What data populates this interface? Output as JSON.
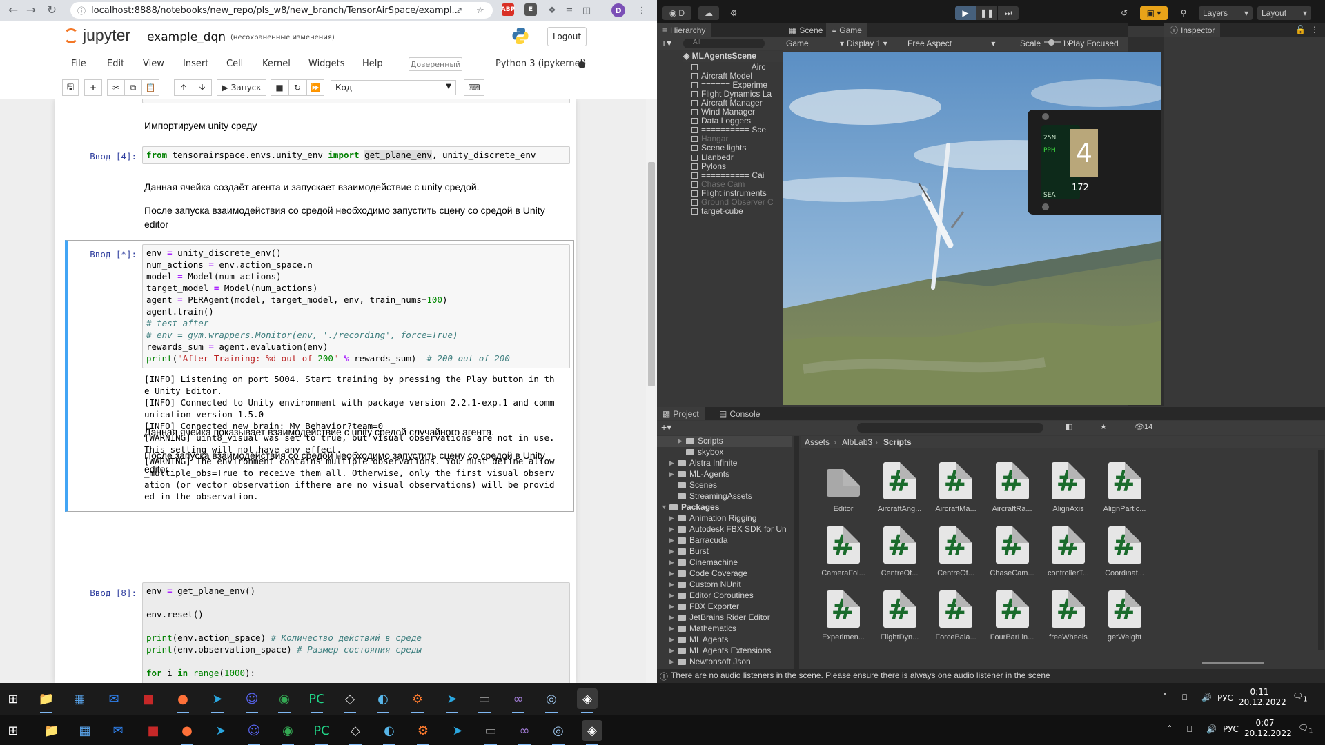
{
  "browser": {
    "url": "localhost:8888/notebooks/new_repo/pls_w8/new_branch/TensorAirSpace/exampl...",
    "ext_abp": "ABP",
    "ext_e": "E",
    "profile": "D"
  },
  "jupyter": {
    "logo": "jupyter",
    "notebook_name": "example_dqn",
    "save_status": "(несохраненные изменения)",
    "logout": "Logout",
    "menu": [
      "File",
      "Edit",
      "View",
      "Insert",
      "Cell",
      "Kernel",
      "Widgets",
      "Help"
    ],
    "trusted": "Доверенный",
    "kernel": "Python 3 (ipykernel)",
    "toolbar": {
      "run": "Запуск",
      "cell_type": "Код"
    }
  },
  "notebook": {
    "md1": "Импортируем unity среду",
    "prompt4": "Ввод [4]:",
    "code4": "from tensorairspace.envs.unity_env import get_plane_env, unity_discrete_env",
    "md2": "Данная ячейка создаёт агента и запускает взаимодействие с unity средой.",
    "md3a": "После запуска взаимодействия со средой необходимо запустить сцену со средой в Unity",
    "md3b": "editor",
    "prompt_star": "Ввод [*]:",
    "code_star": [
      "env = unity_discrete_env()",
      "num_actions = env.action_space.n",
      "model = Model(num_actions)",
      "target_model = Model(num_actions)",
      "agent = PERAgent(model, target_model, env, train_nums=100)",
      "agent.train()",
      "# test after",
      "# env = gym.wrappers.Monitor(env, './recording', force=True)",
      "rewards_sum = agent.evaluation(env)",
      "print(\"After Training: %d out of 200\" % rewards_sum)  # 200 out of 200"
    ],
    "output": [
      "[INFO] Listening on port 5004. Start training by pressing the Play button in th",
      "e Unity Editor.",
      "[INFO] Connected to Unity environment with package version 2.2.1-exp.1 and comm",
      "unication version 1.5.0",
      "[INFO] Connected new brain: My Behavior?team=0",
      "[WARNING] uint8_visual was set to true, but visual observations are not in use.",
      "This setting will not have any effect.",
      "[WARNING] The environment contains multiple observations. You must define allow",
      "_multiple_obs=True to receive them all. Otherwise, only the first visual observ",
      "ation (or vector observation ifthere are no visual observations) will be provid",
      "ed in the observation."
    ],
    "md4": "Данная ячейка показывает взаимодействие с unity средой случайного агента.",
    "md5a": "После запуска взаимодействия со средой необходимо запустить сцену со средой в Unity",
    "md5b": "editor",
    "prompt8": "Ввод [8]:",
    "code8": [
      "env = get_plane_env()",
      "",
      "env.reset()",
      "",
      "print(env.action_space) # Количество действий в среде",
      "print(env.observation_space) # Размер состояния среды",
      "",
      "for i in range(1000):"
    ]
  },
  "unity": {
    "account": "D",
    "layers": "Layers",
    "layout": "Layout",
    "hierarchy_tab": "Hierarchy",
    "search_placeholder": "All",
    "scene_root": "MLAgentsScene",
    "hierarchy": [
      {
        "label": "========== Airc",
        "dim": false,
        "arrow": false
      },
      {
        "label": "Aircraft Model",
        "dim": false,
        "arrow": true
      },
      {
        "label": "====== Experime",
        "dim": false,
        "arrow": false
      },
      {
        "label": "Flight Dynamics La",
        "dim": false,
        "arrow": false
      },
      {
        "label": "Aircraft Manager",
        "dim": false,
        "arrow": false
      },
      {
        "label": "Wind Manager",
        "dim": false,
        "arrow": false
      },
      {
        "label": "Data Loggers",
        "dim": false,
        "arrow": true
      },
      {
        "label": "========== Sce",
        "dim": false,
        "arrow": false
      },
      {
        "label": "Hangar",
        "dim": true,
        "arrow": true
      },
      {
        "label": "Scene lights",
        "dim": false,
        "arrow": false
      },
      {
        "label": "Llanbedr",
        "dim": false,
        "arrow": true
      },
      {
        "label": "Pylons",
        "dim": false,
        "arrow": true
      },
      {
        "label": "========== Cai",
        "dim": false,
        "arrow": false
      },
      {
        "label": "Chase Cam",
        "dim": true,
        "arrow": false
      },
      {
        "label": "Flight instruments",
        "dim": false,
        "arrow": true
      },
      {
        "label": "Ground Observer C",
        "dim": true,
        "arrow": false
      },
      {
        "label": "target-cube",
        "dim": false,
        "arrow": false
      }
    ],
    "scene_tab": "Scene",
    "game_tab": "Game",
    "game_bar": {
      "mode": "Game",
      "display": "Display 1",
      "aspect": "Free Aspect",
      "scale_label": "Scale",
      "scale_value": "1x",
      "play_focused": "Play Focused"
    },
    "inspector_tab": "Inspector",
    "project_tab": "Project",
    "console_tab": "Console",
    "hidden_count": "14",
    "breadcrumb": [
      "Assets",
      "AlbLab3",
      "Scripts"
    ],
    "project_tree": [
      {
        "label": "Scripts",
        "indent": 2,
        "arrow": true,
        "selected": true
      },
      {
        "label": "skybox",
        "indent": 2,
        "arrow": false,
        "selected": false
      },
      {
        "label": "Alstra Infinite",
        "indent": 1,
        "arrow": true,
        "selected": false
      },
      {
        "label": "ML-Agents",
        "indent": 1,
        "arrow": true,
        "selected": false
      },
      {
        "label": "Scenes",
        "indent": 1,
        "arrow": false,
        "selected": false
      },
      {
        "label": "StreamingAssets",
        "indent": 1,
        "arrow": false,
        "selected": false
      }
    ],
    "packages_label": "Packages",
    "packages": [
      "Animation Rigging",
      "Autodesk FBX SDK for Un",
      "Barracuda",
      "Burst",
      "Cinemachine",
      "Code Coverage",
      "Custom NUnit",
      "Editor Coroutines",
      "FBX Exporter",
      "JetBrains Rider Editor",
      "Mathematics",
      "ML Agents",
      "ML Agents Extensions",
      "Newtonsoft Json"
    ],
    "assets": [
      "Editor",
      "AircraftAng...",
      "AircraftMa...",
      "AircraftRa...",
      "AlignAxis",
      "AlignPartic...",
      "CameraFol...",
      "CentreOf...",
      "CentreOf...",
      "ChaseCam...",
      "controllerT...",
      "Coordinat...",
      "Experimen...",
      "FlightDyn...",
      "ForceBala...",
      "FourBarLin...",
      "freeWheels",
      "getWeight"
    ],
    "status": "There are no audio listeners in the scene. Please ensure there is always one audio listener in the scene",
    "hud": {
      "heading": "25N",
      "code": "PPH",
      "big_value": "4",
      "speed": "172",
      "label": "SEA"
    }
  },
  "taskbar": {
    "lang": "РУС",
    "top_time": "0:11",
    "top_date": "20.12.2022",
    "bottom_time": "0:07",
    "bottom_date": "20.12.2022",
    "notif_count": "1"
  }
}
